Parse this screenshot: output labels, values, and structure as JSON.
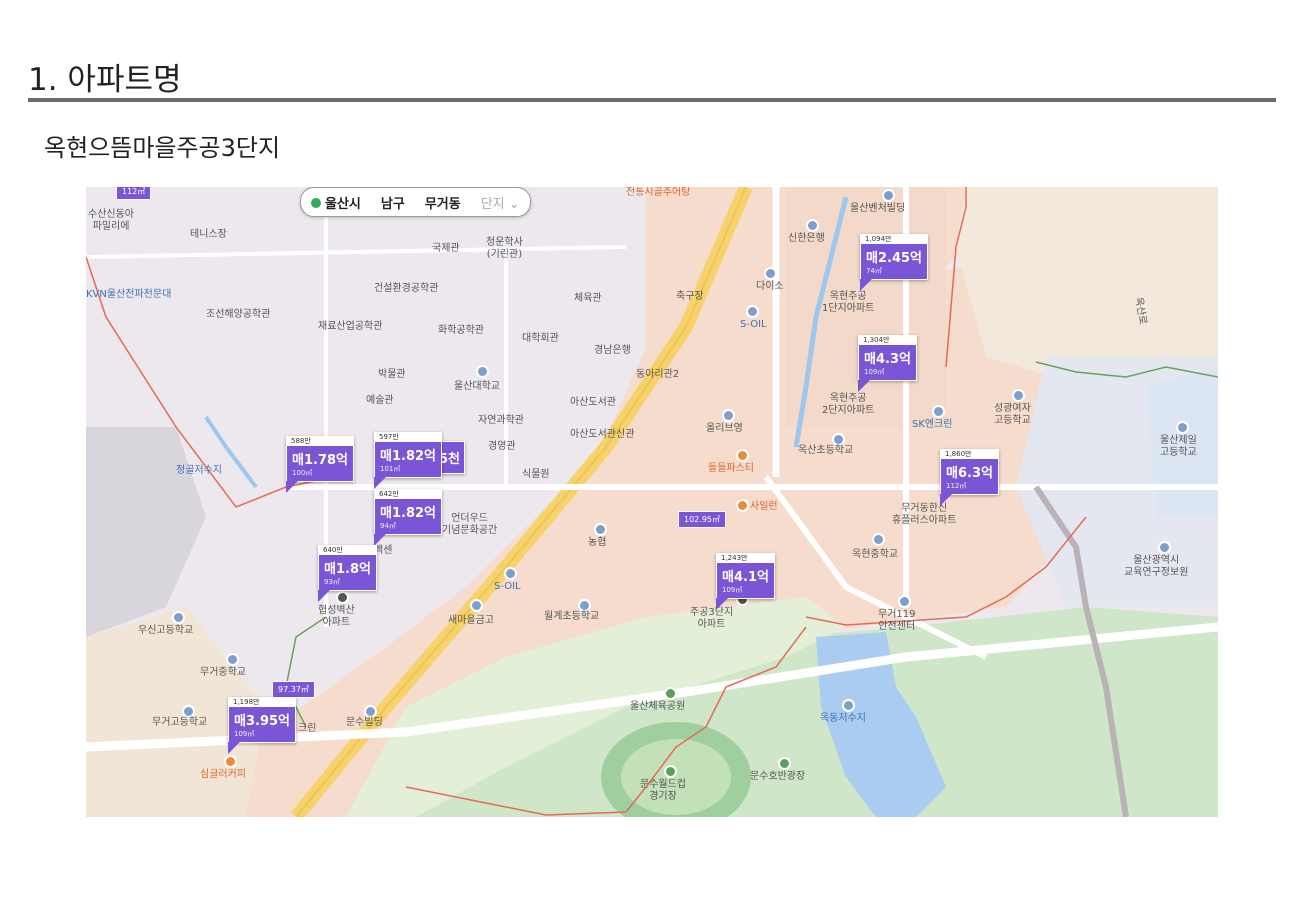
{
  "header": {
    "title": "1. 아파트명",
    "apartment_name": "옥현으뜸마을주공3단지"
  },
  "map": {
    "location_bar": {
      "city": "울산시",
      "district": "남구",
      "dong": "무거동",
      "complex": "단지"
    },
    "places": {
      "p1": "수산신동아\n파밀리에",
      "p2": "테니스장",
      "p3": "KVN울산전파천문대",
      "p4": "조선해양공학관",
      "p5": "건설환경공학관",
      "p6": "재료산업공학관",
      "p7": "화학공학관",
      "p8": "국제관",
      "p9": "청운학사\n(기린관)",
      "p10": "체육관",
      "p11": "축구장",
      "p12": "대학회관",
      "p13": "경남은행",
      "p14": "박물관",
      "p15": "울산대학교",
      "p16": "동아리관2",
      "p17": "예술관",
      "p18": "아산도서관",
      "p19": "자연과학관",
      "p20": "아산도서관신관",
      "p21": "경영관",
      "p22": "식물원",
      "p23": "정골저수지",
      "p24": "언더우드\n기념문화공간",
      "p25": "농협",
      "p26": "S-OIL",
      "p27": "협성벽산\n아파트",
      "p28": "새마을금고",
      "p29": "월계초등학교",
      "p30": "우신고등학교",
      "p31": "무거중학교",
      "p32": "무거고등학교",
      "p33": "문수빌딩",
      "p34": "심글러커피",
      "p35": "울산벤처빌딩",
      "p36": "신한은행",
      "p37": "다이소",
      "p38": "옥현주공\n1단지아파트",
      "p39": "S-OIL",
      "p40": "올리브영",
      "p41": "옥현주공\n2단지아파트",
      "p42": "SK엔크린",
      "p43": "성광여자\n고등학교",
      "p44": "울산제일\n고등학교",
      "p45": "옥산초등학교",
      "p46": "들들파스티",
      "p47": "무거동한신\n휴플러스아파트",
      "p48": "옥현중학교",
      "p49": "울산광역시\n교육연구정보원",
      "p50": "주공3단지\n아파트",
      "p51": "무거119\n안전센터",
      "p52": "울산체육공원",
      "p53": "옥동저수지",
      "p54": "문수월드컵\n경기장",
      "p55": "문수호반광장",
      "p56": "전통시골추어탕",
      "p57": "백센",
      "p58": "크린",
      "p59": "5천",
      "p60": "사일런",
      "p61": "옥산로"
    },
    "markers": [
      {
        "head": "588만",
        "price": "매1.78억",
        "area": "100㎡"
      },
      {
        "head": "597만",
        "price": "매1.82억",
        "area": "101㎡"
      },
      {
        "head": "642만",
        "price": "매1.82억",
        "area": "94㎡"
      },
      {
        "head": "640만",
        "price": "매1.8억",
        "area": "93㎡"
      },
      {
        "head": "1,198만",
        "price": "매3.95억",
        "area": "109㎡"
      },
      {
        "head": "1,094만",
        "price": "매2.45억",
        "area": "74㎡"
      },
      {
        "head": "1,304만",
        "price": "매4.3억",
        "area": "109㎡"
      },
      {
        "head": "1,860만",
        "price": "매6.3억",
        "area": "112㎡"
      },
      {
        "head": "1,243만",
        "price": "매4.1억",
        "area": "109㎡"
      }
    ],
    "tags": {
      "t1": "102.95㎡",
      "t2": "97.37㎡",
      "t3": "112㎡"
    }
  }
}
